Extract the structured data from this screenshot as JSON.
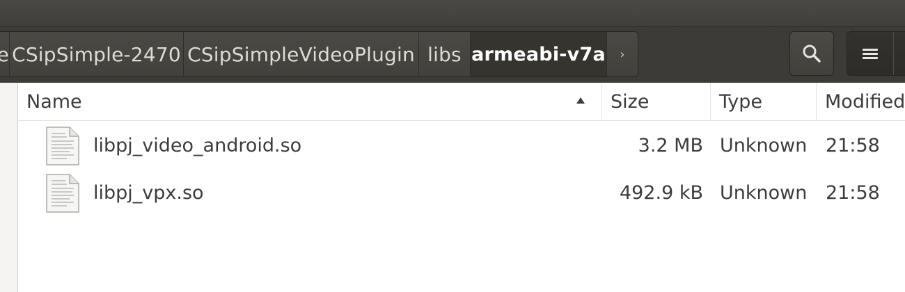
{
  "breadcrumbs": [
    {
      "label": "e",
      "active": false
    },
    {
      "label": "CSipSimple-2470",
      "active": false
    },
    {
      "label": "CSipSimpleVideoPlugin",
      "active": false
    },
    {
      "label": "libs",
      "active": false
    },
    {
      "label": "armeabi-v7a",
      "active": true
    }
  ],
  "toolbar": {
    "forward_arrow": "›",
    "search_icon": "search-icon",
    "menu_icon": "hamburger-menu-icon"
  },
  "columns": {
    "name": "Name",
    "size": "Size",
    "type": "Type",
    "modified": "Modified"
  },
  "sort": {
    "column": "name",
    "direction": "ascending"
  },
  "files": [
    {
      "name": "libpj_video_android.so",
      "size": "3.2 MB",
      "type": "Unknown",
      "modified": "21:58",
      "icon": "text-file-icon"
    },
    {
      "name": "libpj_vpx.so",
      "size": "492.9 kB",
      "type": "Unknown",
      "modified": "21:58",
      "icon": "text-file-icon"
    }
  ],
  "colors": {
    "header_bg": "#3c3b37",
    "active_crumb_bg": "#35342f",
    "text": "#3c3c3c"
  }
}
